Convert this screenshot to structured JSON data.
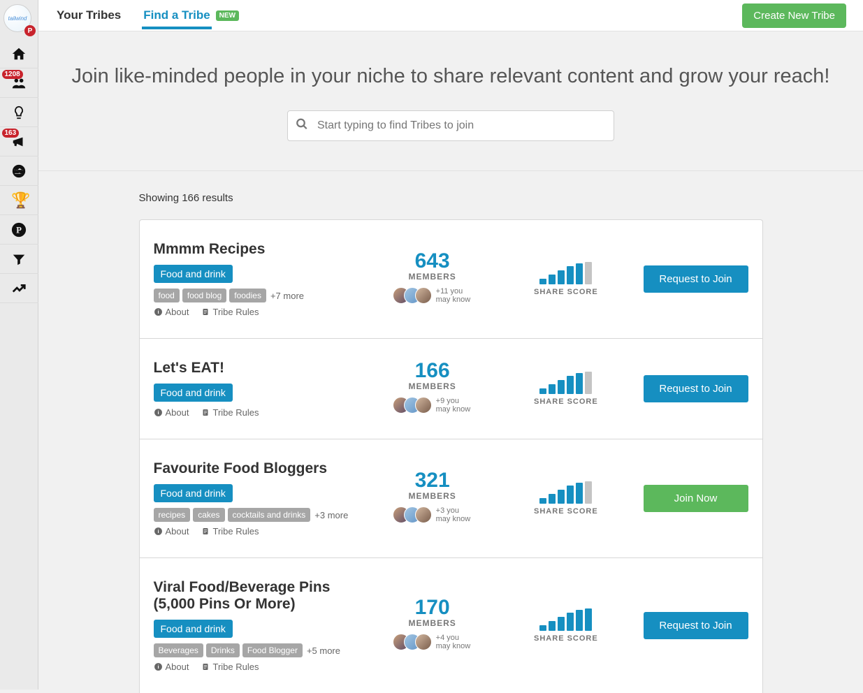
{
  "logo_text": "tailwind",
  "nav": {
    "home_badge": null,
    "people_badge": "1208",
    "bulb_badge": null,
    "megaphone_badge": "163"
  },
  "tabs": {
    "your_tribes": "Your Tribes",
    "find_a_tribe": "Find a Tribe",
    "new_label": "NEW"
  },
  "create_button": "Create New Tribe",
  "hero": {
    "headline": "Join like-minded people in your niche to share relevant content and grow your reach!",
    "search_placeholder": "Start typing to find Tribes to join"
  },
  "results_label": "Showing 166 results",
  "members_label": "MEMBERS",
  "share_score_label": "SHARE SCORE",
  "about_label": "About",
  "rules_label": "Tribe Rules",
  "cards": [
    {
      "title": "Mmmm Recipes",
      "category": "Food and drink",
      "tags": [
        "food",
        "food blog",
        "foodies"
      ],
      "more_tags": "+7 more",
      "members": "643",
      "know": "+11 you may know",
      "bars": [
        8,
        14,
        20,
        26,
        30,
        32
      ],
      "dim_last": true,
      "action": "Request to Join",
      "action_style": "blue"
    },
    {
      "title": "Let's EAT!",
      "category": "Food and drink",
      "tags": [],
      "more_tags": "",
      "members": "166",
      "know": "+9 you may know",
      "bars": [
        8,
        14,
        20,
        26,
        30,
        32
      ],
      "dim_last": true,
      "action": "Request to Join",
      "action_style": "blue"
    },
    {
      "title": "Favourite Food Bloggers",
      "category": "Food and drink",
      "tags": [
        "recipes",
        "cakes",
        "cocktails and drinks"
      ],
      "more_tags": "+3 more",
      "members": "321",
      "know": "+3 you may know",
      "bars": [
        8,
        14,
        20,
        26,
        30,
        32
      ],
      "dim_last": true,
      "action": "Join Now",
      "action_style": "green"
    },
    {
      "title": "Viral Food/Beverage Pins (5,000 Pins Or More)",
      "category": "Food and drink",
      "tags": [
        "Beverages",
        "Drinks",
        "Food Blogger"
      ],
      "more_tags": "+5 more",
      "members": "170",
      "know": "+4 you may know",
      "bars": [
        8,
        14,
        20,
        26,
        30,
        32
      ],
      "dim_last": false,
      "action": "Request to Join",
      "action_style": "blue"
    }
  ]
}
